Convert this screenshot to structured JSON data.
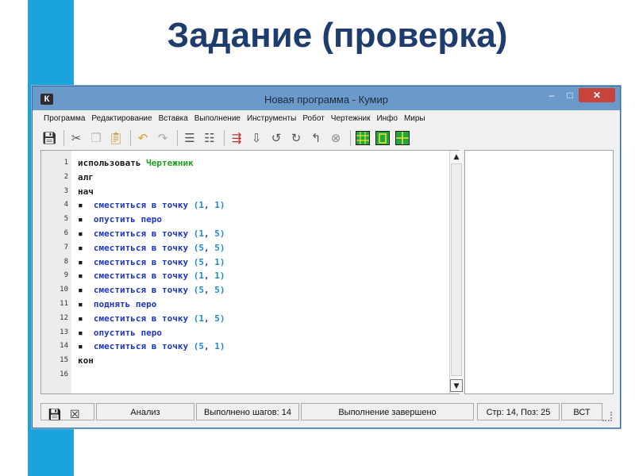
{
  "slide": {
    "title": "Задание (проверка)",
    "accent_color": "#1aa3dc"
  },
  "window": {
    "title": "Новая программа - Кумир",
    "app_icon": "К",
    "minimize_icon": "minimize-icon",
    "maximize_icon": "maximize-icon",
    "close_icon": "close-icon"
  },
  "menu": {
    "items": [
      "Программа",
      "Редактирование",
      "Вставка",
      "Выполнение",
      "Инструменты",
      "Робот",
      "Чертежник",
      "Инфо",
      "Миры"
    ]
  },
  "toolbar": {
    "icons": [
      "save-icon",
      "cut-icon",
      "copy-icon",
      "paste-icon",
      "undo-icon",
      "redo-icon",
      "insert-block-icon",
      "remove-block-icon",
      "run-icon",
      "run-step-icon",
      "step-over-icon",
      "step-in-icon",
      "step-out-icon",
      "stop-icon",
      "robot-field-icon",
      "robot-frame-icon",
      "draftsman-icon"
    ]
  },
  "editor": {
    "lines": [
      {
        "n": "1",
        "parts": [
          {
            "t": "использовать ",
            "c": "kw"
          },
          {
            "t": "Чертежник",
            "c": "robot"
          }
        ]
      },
      {
        "n": "2",
        "parts": [
          {
            "t": "алг",
            "c": "kw"
          }
        ]
      },
      {
        "n": "3",
        "parts": [
          {
            "t": "нач",
            "c": "kw"
          }
        ]
      },
      {
        "n": "4",
        "parts": [
          {
            "t": "▪  ",
            "c": "bullet"
          },
          {
            "t": "сместиться в точку ",
            "c": "cmd"
          },
          {
            "t": "(",
            "c": "num"
          },
          {
            "t": "1",
            "c": "num"
          },
          {
            "t": ", ",
            "c": "cmd"
          },
          {
            "t": "1",
            "c": "num"
          },
          {
            "t": ")",
            "c": "num"
          }
        ]
      },
      {
        "n": "5",
        "parts": [
          {
            "t": "▪  ",
            "c": "bullet"
          },
          {
            "t": "опустить перо",
            "c": "cmd"
          }
        ]
      },
      {
        "n": "6",
        "parts": [
          {
            "t": "▪  ",
            "c": "bullet"
          },
          {
            "t": "сместиться в точку ",
            "c": "cmd"
          },
          {
            "t": "(",
            "c": "num"
          },
          {
            "t": "1",
            "c": "num"
          },
          {
            "t": ", ",
            "c": "cmd"
          },
          {
            "t": "5",
            "c": "num"
          },
          {
            "t": ")",
            "c": "num"
          }
        ]
      },
      {
        "n": "7",
        "parts": [
          {
            "t": "▪  ",
            "c": "bullet"
          },
          {
            "t": "сместиться в точку ",
            "c": "cmd"
          },
          {
            "t": "(",
            "c": "num"
          },
          {
            "t": "5",
            "c": "num"
          },
          {
            "t": ", ",
            "c": "cmd"
          },
          {
            "t": "5",
            "c": "num"
          },
          {
            "t": ")",
            "c": "num"
          }
        ]
      },
      {
        "n": "8",
        "parts": [
          {
            "t": "▪  ",
            "c": "bullet"
          },
          {
            "t": "сместиться в точку ",
            "c": "cmd"
          },
          {
            "t": "(",
            "c": "num"
          },
          {
            "t": "5",
            "c": "num"
          },
          {
            "t": ", ",
            "c": "cmd"
          },
          {
            "t": "1",
            "c": "num"
          },
          {
            "t": ")",
            "c": "num"
          }
        ]
      },
      {
        "n": "9",
        "parts": [
          {
            "t": "▪  ",
            "c": "bullet"
          },
          {
            "t": "сместиться в точку ",
            "c": "cmd"
          },
          {
            "t": "(",
            "c": "num"
          },
          {
            "t": "1",
            "c": "num"
          },
          {
            "t": ", ",
            "c": "cmd"
          },
          {
            "t": "1",
            "c": "num"
          },
          {
            "t": ")",
            "c": "num"
          }
        ]
      },
      {
        "n": "10",
        "parts": [
          {
            "t": "▪  ",
            "c": "bullet"
          },
          {
            "t": "сместиться в точку ",
            "c": "cmd"
          },
          {
            "t": "(",
            "c": "num"
          },
          {
            "t": "5",
            "c": "num"
          },
          {
            "t": ", ",
            "c": "cmd"
          },
          {
            "t": "5",
            "c": "num"
          },
          {
            "t": ")",
            "c": "num"
          }
        ]
      },
      {
        "n": "11",
        "parts": [
          {
            "t": "▪  ",
            "c": "bullet"
          },
          {
            "t": "поднять перо",
            "c": "cmd"
          }
        ]
      },
      {
        "n": "12",
        "parts": [
          {
            "t": "▪  ",
            "c": "bullet"
          },
          {
            "t": "сместиться в точку ",
            "c": "cmd"
          },
          {
            "t": "(",
            "c": "num"
          },
          {
            "t": "1",
            "c": "num"
          },
          {
            "t": ", ",
            "c": "cmd"
          },
          {
            "t": "5",
            "c": "num"
          },
          {
            "t": ")",
            "c": "num"
          }
        ]
      },
      {
        "n": "13",
        "parts": [
          {
            "t": "▪  ",
            "c": "bullet"
          },
          {
            "t": "опустить перо",
            "c": "cmd"
          }
        ]
      },
      {
        "n": "14",
        "parts": [
          {
            "t": "▪  ",
            "c": "bullet"
          },
          {
            "t": "сместиться в точку ",
            "c": "cmd"
          },
          {
            "t": "(",
            "c": "num"
          },
          {
            "t": "5",
            "c": "num"
          },
          {
            "t": ", ",
            "c": "cmd"
          },
          {
            "t": "1",
            "c": "num"
          },
          {
            "t": ")",
            "c": "num"
          }
        ]
      },
      {
        "n": "15",
        "parts": [
          {
            "t": "кон",
            "c": "kw"
          }
        ]
      },
      {
        "n": "16",
        "parts": []
      }
    ],
    "scroll_up_icon": "scroll-up-icon",
    "scroll_down_icon": "scroll-down-icon"
  },
  "status": {
    "icons": [
      "save-icon",
      "close-box-icon"
    ],
    "mode": "Анализ",
    "steps": "Выполнено шагов: 14",
    "state": "Выполнение завершено",
    "position": "Стр: 14, Поз: 25",
    "insert_mode": "ВСТ"
  }
}
